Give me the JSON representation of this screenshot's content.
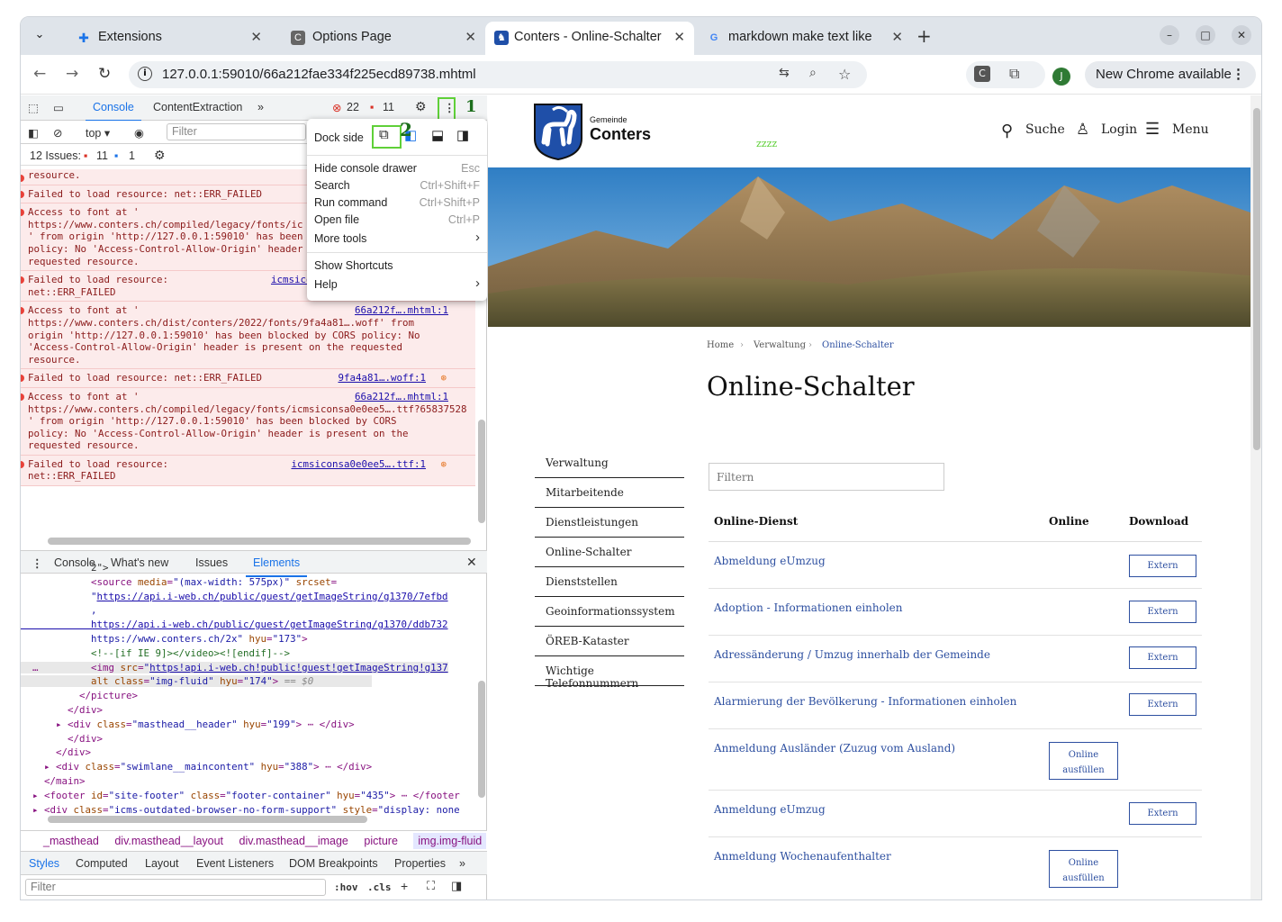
{
  "browser": {
    "tabs": [
      {
        "title": "Extensions",
        "icon": "puzzle-icon",
        "active": false
      },
      {
        "title": "Options Page",
        "icon": "page-icon",
        "active": false
      },
      {
        "title": "Conters - Online-Schalter",
        "icon": "ibex-crest-icon",
        "active": true
      },
      {
        "title": "markdown make text like",
        "icon": "google-icon",
        "active": false
      }
    ],
    "new_tab": "+",
    "url": "127.0.0.1:59010/66a212fae334f225ecd89738.mhtml",
    "profile_initial": "J",
    "update_label": "New Chrome available"
  },
  "devtools": {
    "top_tabs": [
      "Console",
      "ContentExtraction"
    ],
    "error_count": "22",
    "warning_count": "11",
    "context": "top",
    "filter_placeholder": "Filter",
    "issues_label": "12 Issues:",
    "issues_errors": "11",
    "issues_info": "1",
    "console_messages": [
      {
        "text": "resource.",
        "source": ""
      },
      {
        "text": "Failed to load resource: net::ERR_FAILED",
        "source": ""
      },
      {
        "text": "Access to font at '\nhttps://www.conters.ch/compiled/legacy/fonts/ic\n' from origin 'http://127.0.0.1:59010' has been\npolicy: No 'Access-Control-Allow-Origin' header\nrequested resource.",
        "source": ""
      },
      {
        "text": "Failed to load resource:\nnet::ERR_FAILED",
        "source": "icmsicon"
      },
      {
        "text": "Access to font at '\nhttps://www.conters.ch/dist/conters/2022/fonts/9fa4a81….woff' from\norigin 'http://127.0.0.1:59010' has been blocked by CORS policy: No\n'Access-Control-Allow-Origin' header is present on the requested\nresource.",
        "source": "66a212f….mhtml:1"
      },
      {
        "text": "Failed to load resource: net::ERR_FAILED",
        "source": "9fa4a81….woff:1"
      },
      {
        "text": "Access to font at '\nhttps://www.conters.ch/compiled/legacy/fonts/icmsiconsa0e0ee5….ttf?65837528\n' from origin 'http://127.0.0.1:59010' has been blocked by CORS\npolicy: No 'Access-Control-Allow-Origin' header is present on the\nrequested resource.",
        "source": "66a212f….mhtml:1"
      },
      {
        "text": "Failed to load resource:\nnet::ERR_FAILED",
        "source": "icmsiconsa0e0ee5….ttf:1"
      }
    ],
    "drawer_tabs": [
      "Console",
      "What's new",
      "Issues",
      "Elements"
    ],
    "breadcrumbs": [
      "_masthead",
      "div.masthead__layout",
      "div.masthead__image",
      "picture",
      "img.img-fluid"
    ],
    "styles_tabs": [
      "Styles",
      "Computed",
      "Layout",
      "Event Listeners",
      "DOM Breakpoints",
      "Properties"
    ],
    "styles_filter": "Filter",
    "hov": ":hov",
    "cls": ".cls"
  },
  "menu": {
    "dock_side": "Dock side",
    "items": [
      {
        "label": "Hide console drawer",
        "key": "Esc"
      },
      {
        "label": "Search",
        "key": "Ctrl+Shift+F"
      },
      {
        "label": "Run command",
        "key": "Ctrl+Shift+P"
      },
      {
        "label": "Open file",
        "key": "Ctrl+P"
      },
      {
        "label": "More tools",
        "key": "›"
      },
      {
        "label": "Show Shortcuts",
        "key": ""
      },
      {
        "label": "Help",
        "key": "›"
      }
    ],
    "annotation_1": "1",
    "annotation_2": "2"
  },
  "site": {
    "logo_small": "Gemeinde",
    "logo_big": "Conters",
    "zzzz": "zzzz",
    "search": "Suche",
    "login": "Login",
    "menu": "Menu",
    "breadcrumbs": [
      "Home",
      "Verwaltung",
      "Online-Schalter"
    ],
    "title": "Online-Schalter",
    "sidebar": [
      "Verwaltung",
      "Mitarbeitende",
      "Dienstleistungen",
      "Online-Schalter",
      "Dienststellen",
      "Geoinformationssystem",
      "ÖREB-Kataster",
      "Wichtige Telefonnummern"
    ],
    "filter_placeholder": "Filtern",
    "columns": [
      "Online-Dienst",
      "Online",
      "Download"
    ],
    "rows": [
      {
        "name": "Abmeldung eUmzug",
        "button": "Extern",
        "type": "download"
      },
      {
        "name": "Adoption - Informationen einholen",
        "button": "Extern",
        "type": "download"
      },
      {
        "name": "Adressänderung / Umzug innerhalb der Gemeinde",
        "button": "Extern",
        "type": "download"
      },
      {
        "name": "Alarmierung der Bevölkerung - Informationen einholen",
        "button": "Extern",
        "type": "download"
      },
      {
        "name": "Anmeldung Ausländer (Zuzug vom Ausland)",
        "button": "Online ausfüllen",
        "type": "online"
      },
      {
        "name": "Anmeldung eUmzug",
        "button": "Extern",
        "type": "download"
      },
      {
        "name": "Anmeldung Wochenaufenthalter",
        "button": "Online ausfüllen",
        "type": "online"
      }
    ]
  }
}
